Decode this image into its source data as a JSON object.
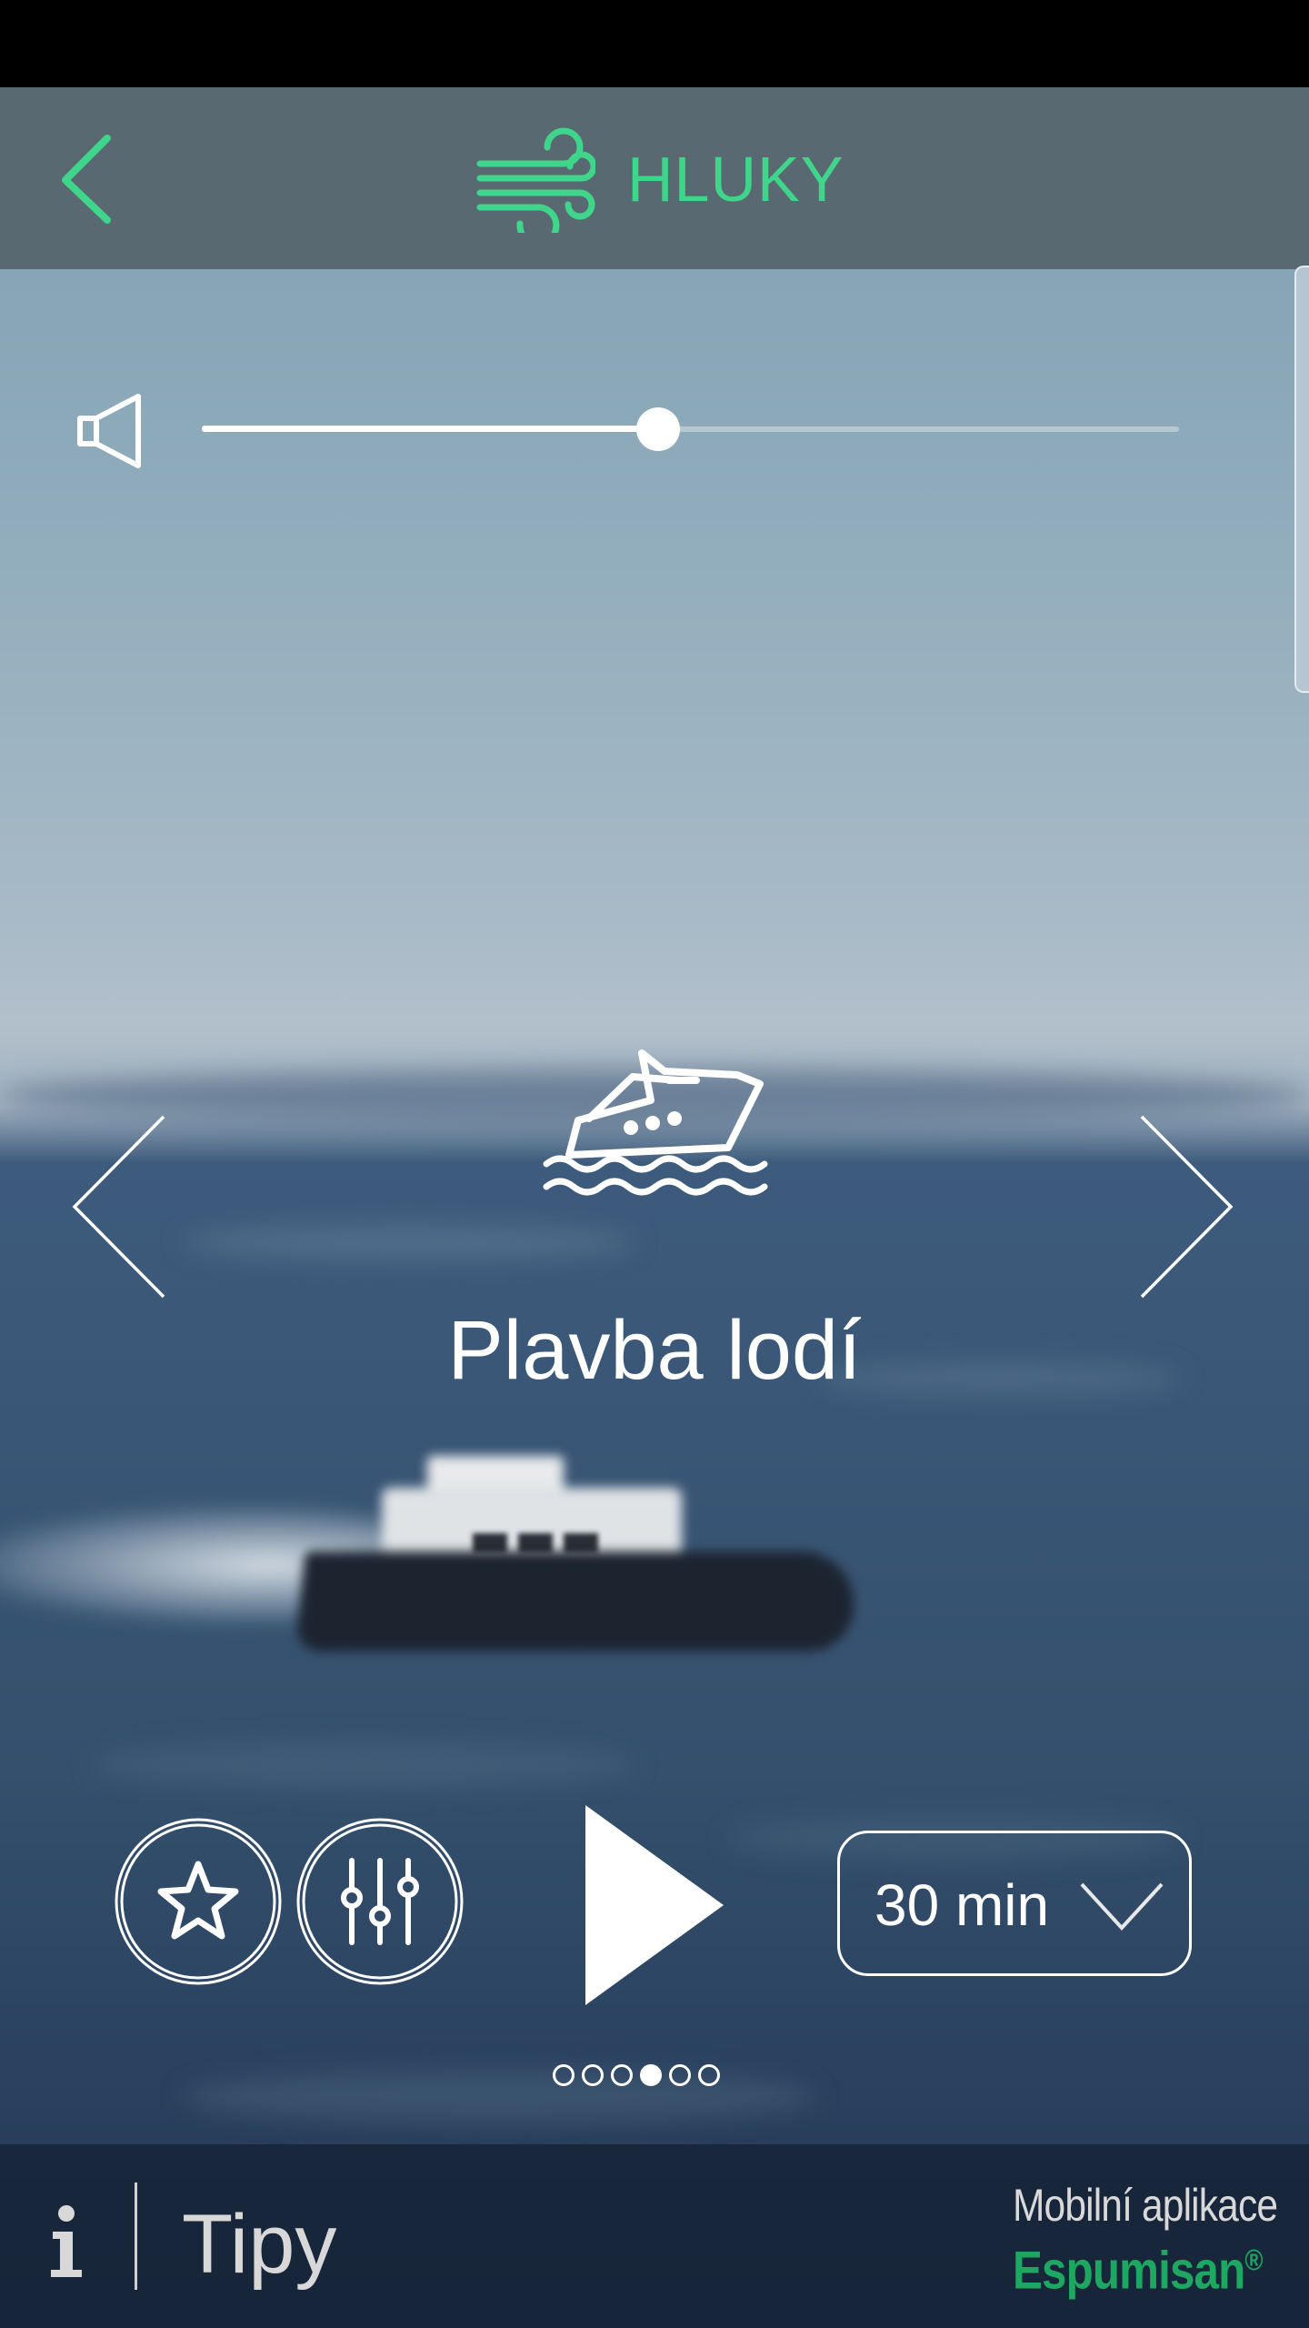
{
  "header": {
    "title": "HLUKY",
    "back_icon": "chevron-left-icon",
    "category_icon": "wind-icon",
    "accent_color": "#3fd58a"
  },
  "volume": {
    "icon": "speaker-icon",
    "level": 0.467
  },
  "sound": {
    "icon": "boat-icon",
    "name": "Plavba lodí"
  },
  "controls": {
    "favorite_icon": "star-icon",
    "mixer_icon": "sliders-icon",
    "play_icon": "play-icon",
    "timer_value": "30 min",
    "timer_chevron_icon": "chevron-down-icon"
  },
  "pager": {
    "count": 6,
    "active_index": 3
  },
  "footer": {
    "info_icon": "info-icon",
    "tips_label": "Tipy",
    "brand_line1": "Mobilní aplikace",
    "brand_line2": "Espumisan",
    "brand_mark": "®",
    "brand_color": "#1ea760"
  }
}
